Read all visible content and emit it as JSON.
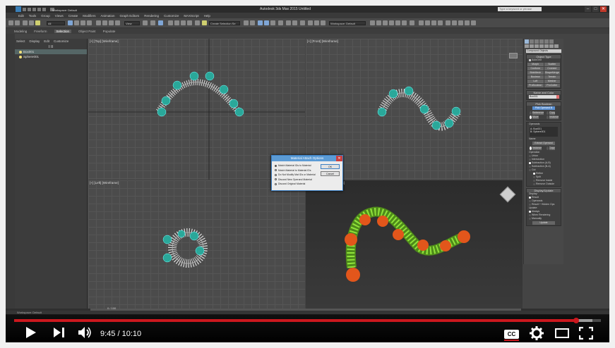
{
  "app": {
    "title": "Autodesk 3ds Max 2015   Untitled",
    "workspace": "Workspace: Default",
    "search_placeholder": "Type a keyword or phrase"
  },
  "menubar": [
    "Edit",
    "Tools",
    "Group",
    "Views",
    "Create",
    "Modifiers",
    "Animation",
    "Graph Editors",
    "Rendering",
    "Customize",
    "MAXScript",
    "Help"
  ],
  "toolbar": {
    "selection_filter": "All",
    "view": "View",
    "selection_set": "Create Selection Se"
  },
  "ribbon": {
    "tabs": [
      "Modeling",
      "Freeform",
      "Selection",
      "Object Paint",
      "Populate"
    ],
    "active_index": 2
  },
  "scene_explorer": {
    "menu": [
      "Select",
      "Display",
      "Edit",
      "Customize"
    ],
    "items": [
      {
        "label": "Box001"
      },
      {
        "label": "Sphere001"
      }
    ]
  },
  "viewports": {
    "top": "[+] [Top] [Wireframe]",
    "front": "[+] [Front] [Wireframe]",
    "left": "[+] [Left] [Wireframe]",
    "persp": "[+] [Perspective] [Realistic]"
  },
  "command_panel": {
    "category": "Compound Objects",
    "object_type_title": "Object Type",
    "autogrid": "AutoGrid",
    "buttons": [
      "Morph",
      "Scatter",
      "Conform",
      "Connect",
      "BlobMesh",
      "ShapeMerge",
      "Boolean",
      "Terrain",
      "Loft",
      "Mesher",
      "ProBoolean",
      "ProCutter"
    ],
    "name_color_title": "Name and Color",
    "name_value": "Box001",
    "pick_title": "Pick Boolean",
    "pick_button": "Pick Operand B",
    "pick_modes": [
      "Reference",
      "Copy",
      "Move",
      "Instance"
    ],
    "operands_title": "Operands",
    "operands": [
      "A: Box001",
      "B: Sphere001"
    ],
    "name_label": "Name:",
    "extract_button": "Extract Operand",
    "extract_modes": [
      "Instance",
      "Copy"
    ],
    "operation_title": "Operation",
    "operations": [
      "Union",
      "Intersection",
      "Subtraction (A-B)",
      "Subtraction (B-A)",
      "Cut"
    ],
    "cut_options": [
      "Refine",
      "Split",
      "Remove Inside",
      "Remove Outside"
    ],
    "display_update_title": "Display/Update",
    "display_label": "Display:",
    "display_options": [
      "Result",
      "Operands",
      "Result + Hidden Ops"
    ],
    "update_label": "Update:",
    "update_options": [
      "Always",
      "When Rendering",
      "Manually"
    ],
    "update_button": "Update"
  },
  "dialog": {
    "title": "Material Attach Options",
    "options": [
      "Match Material IDs to Material",
      "Match Material to Material IDs",
      "Do Not Modify Mat IDs or Material",
      "Discard New Operand Material",
      "Discard Original Material"
    ],
    "selected_index": 0,
    "ok": "OK",
    "cancel": "Cancel"
  },
  "status": {
    "workspace": "Workspace: Default",
    "frame": "0 / 100"
  },
  "video": {
    "current_time": "9:45",
    "duration": "10:10",
    "played_fraction": 0.958,
    "loaded_fraction": 0.985,
    "colors": {
      "played": "#cc181e",
      "background": "#000000"
    }
  }
}
